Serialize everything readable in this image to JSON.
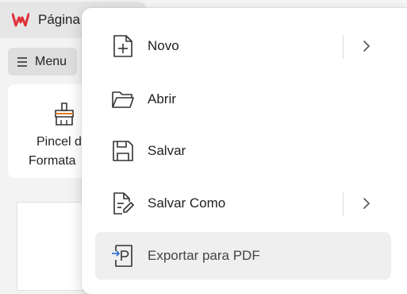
{
  "app_tab": {
    "title": "Página"
  },
  "toolbar": {
    "menu_label": "Menu"
  },
  "ribbon": {
    "format_painter_line1": "Pincel d",
    "format_painter_line2": "Formata"
  },
  "dropdown": {
    "items": [
      {
        "label": "Novo",
        "icon": "new-file-icon",
        "has_submenu": true
      },
      {
        "label": "Abrir",
        "icon": "folder-open-icon",
        "has_submenu": false
      },
      {
        "label": "Salvar",
        "icon": "save-icon",
        "has_submenu": false
      },
      {
        "label": "Salvar Como",
        "icon": "save-as-icon",
        "has_submenu": true
      },
      {
        "label": "Exportar para PDF",
        "icon": "export-pdf-icon",
        "has_submenu": false,
        "highlighted": true
      }
    ]
  },
  "colors": {
    "wps_brand": "#e0303a",
    "accent_blue": "#2b6cd8",
    "highlight": "#efefef"
  }
}
